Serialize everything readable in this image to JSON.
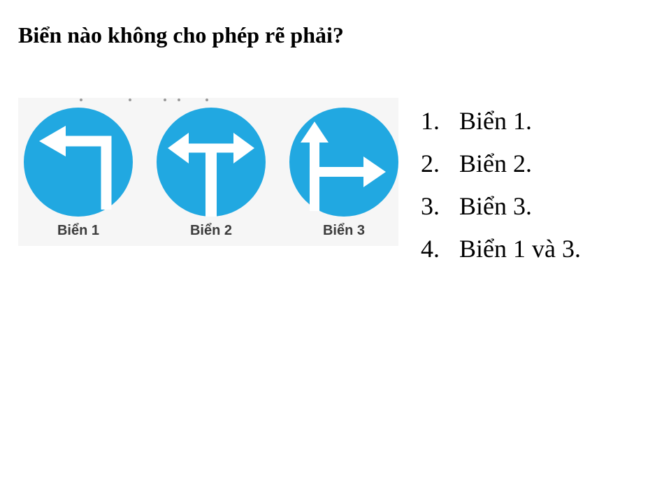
{
  "question": {
    "text": "Biển nào không cho phép rẽ phải?"
  },
  "signs": [
    {
      "label": "Biển 1",
      "icon": "turn-left-arrow-icon"
    },
    {
      "label": "Biển 2",
      "icon": "left-right-arrow-icon"
    },
    {
      "label": "Biển 3",
      "icon": "straight-or-right-arrow-icon"
    }
  ],
  "options": [
    {
      "number": "1.",
      "text": "Biển 1."
    },
    {
      "number": "2.",
      "text": "Biển 2."
    },
    {
      "number": "3.",
      "text": "Biển 3."
    },
    {
      "number": "4.",
      "text": "Biển 1 và 3."
    }
  ],
  "colors": {
    "sign_blue": "#21A8E1",
    "arrow_white": "#FFFFFF",
    "label_gray": "#3C3C3C",
    "panel_bg": "#F6F6F6"
  }
}
